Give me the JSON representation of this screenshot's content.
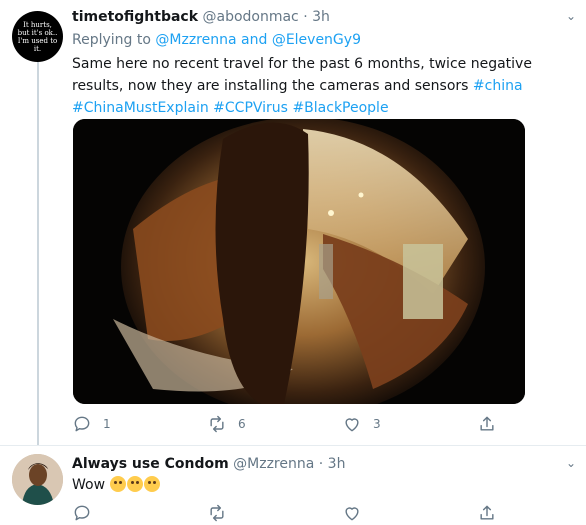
{
  "tweet1": {
    "avatar_text": "It hurts, but it's ok.. I'm used to it.",
    "display_name": "timetofightback",
    "handle": "@abodonmac",
    "dot": "·",
    "time": "3h",
    "replying_prefix": "Replying to",
    "reply_user1": "@Mzzrenna",
    "reply_and": "and",
    "reply_user2": "@ElevenGy9",
    "text": "Same here no recent travel for the past 6 months, twice negative results, now they are installing the cameras and sensors",
    "hashtags": [
      "#china",
      "#ChinaMustExplain",
      "#CCPVirus",
      "#BlackPeople"
    ],
    "reply_count": "1",
    "retweet_count": "6",
    "like_count": "3"
  },
  "tweet2": {
    "display_name": "Always use Condom",
    "handle": "@Mzzrenna",
    "dot": "·",
    "time": "3h",
    "text": "Wow"
  },
  "icons": [
    "chevron-down-icon",
    "reply-icon",
    "retweet-icon",
    "like-icon",
    "share-icon"
  ],
  "colors": {
    "link": "#1da1f2",
    "secondary": "#657786",
    "text": "#14171a"
  }
}
